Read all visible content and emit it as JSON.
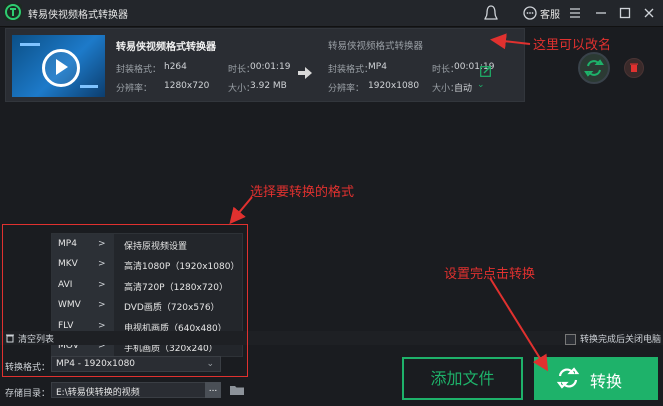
{
  "app": {
    "title": "转易侠视频格式转换器",
    "kefu_label": "客服"
  },
  "file": {
    "source_name": "转易侠视频格式转换器",
    "output_name": "转易侠视频格式转换器",
    "source": {
      "codec_label": "封装格式：",
      "codec": "h264",
      "duration_label": "时长：",
      "duration": "00:01:19",
      "resolution_label": "分辨率：",
      "resolution": "1280x720",
      "size_label": "大小：",
      "size": "3.92 MB"
    },
    "output": {
      "codec_label": "封装格式：",
      "codec": "MP4",
      "duration_label": "时长：",
      "duration": "00:01:19",
      "resolution_label": "分辨率：",
      "resolution": "1920x1080",
      "size_label": "大小：",
      "size": "自动"
    }
  },
  "annotations": {
    "rename": "这里可以改名",
    "choose_format": "选择要转换的格式",
    "click_convert": "设置完点击转换"
  },
  "format_menu": {
    "containers": [
      "MP4",
      "MKV",
      "AVI",
      "WMV",
      "FLV",
      "MOV"
    ],
    "chevron": ">",
    "options": [
      "保持原视频设置",
      "高清1080P（1920x1080）",
      "高清720P（1280x720）",
      "DVD画质（720x576）",
      "电视机画质（640x480）",
      "手机画质（320x240）"
    ]
  },
  "bottom": {
    "clear_list": "清空列表",
    "close_after": "转换完成后关闭电脑",
    "format_label": "转换格式：",
    "format_value": "MP4 - 1920x1080",
    "dir_label": "存储目录：",
    "dir_value": "E:\\转易侠转换的视频",
    "dir_more": "...",
    "add_file": "添加文件",
    "convert": "转换"
  },
  "colors": {
    "accent": "#1eb26a",
    "annotation": "#e0312f"
  }
}
